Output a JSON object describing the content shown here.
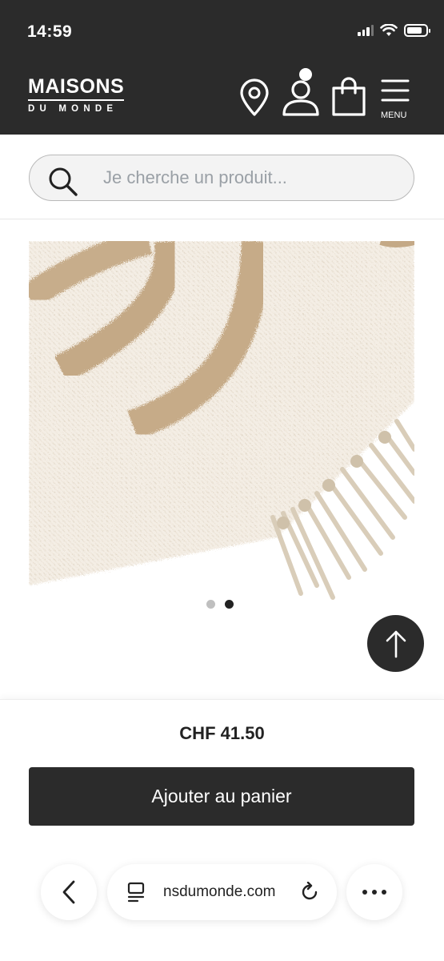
{
  "status_bar": {
    "time": "14:59",
    "icons": [
      "signal-icon",
      "wifi-icon",
      "battery-icon"
    ]
  },
  "header": {
    "logo_main": "MAISONS",
    "logo_sub": "DU MONDE",
    "icons": [
      "location-pin-icon",
      "account-icon",
      "shopping-bag-icon",
      "hamburger-menu-icon"
    ],
    "menu_label": "MENU",
    "background": "#2b2b2b"
  },
  "search": {
    "placeholder": "Je cherche un produit...",
    "value": ""
  },
  "product": {
    "image_alt": "rug-photo",
    "carousel": {
      "count": 2,
      "active_index": 2
    },
    "price": "CHF 41.50",
    "add_to_cart_label": "Ajouter au panier"
  },
  "browser_bar": {
    "url": "nsdumonde.com",
    "buttons": [
      "back-icon",
      "tabs-icon",
      "reload-icon",
      "more-icon"
    ]
  },
  "colors": {
    "dark": "#2b2b2b",
    "rug_cream": "#f3ece2",
    "rug_stripe": "#c9b08f"
  }
}
